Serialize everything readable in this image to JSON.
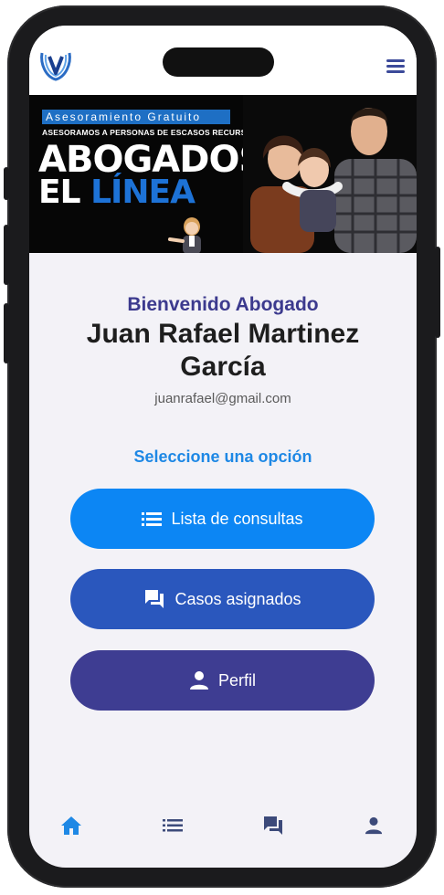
{
  "app": {
    "name": "Abogados en Línea"
  },
  "banner": {
    "tag": "Asesoramiento Gratuito",
    "subtitle": "ASESORAMOS A PERSONAS DE ESCASOS RECURSOS",
    "title_line1": "ABOGADOS",
    "title_line2_a": "EL",
    "title_line2_b": "LÍNEA"
  },
  "main": {
    "welcome": "Bienvenido Abogado",
    "user_name": "Juan Rafael  Martinez García",
    "email": "juanrafael@gmail.com",
    "select_prompt": "Seleccione una  opción"
  },
  "buttons": {
    "consultas": "Lista de consultas",
    "casos": "Casos asignados",
    "perfil": "Perfil"
  },
  "bottom_nav": {
    "items": [
      "home-icon",
      "list-icon",
      "chat-icon",
      "person-icon"
    ],
    "active": "home-icon"
  },
  "colors": {
    "accent": "#1e88e5",
    "btn_consultas": "#0c86f4",
    "btn_casos": "#2a57bd",
    "btn_perfil": "#3e3d92",
    "title": "#3c3a8e",
    "nav_inactive": "#3c4a7a"
  }
}
